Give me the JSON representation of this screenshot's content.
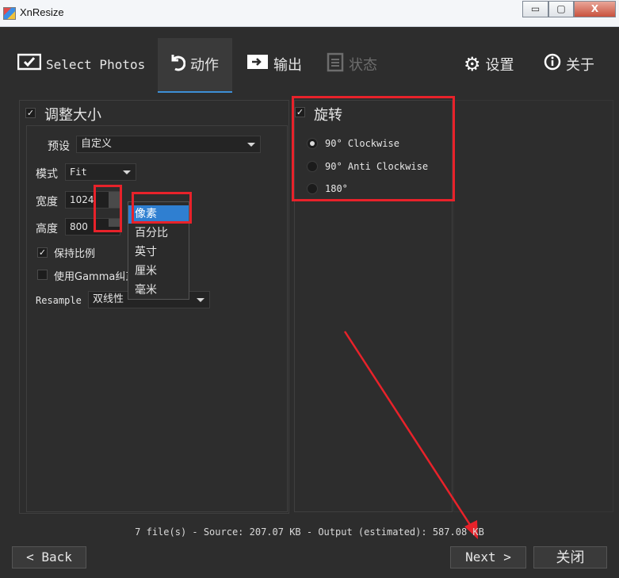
{
  "window": {
    "title": "XnResize",
    "controls": {
      "minimize": "▭",
      "maximize": "▢",
      "close": "X"
    }
  },
  "tabs": [
    {
      "label": "Select Photos",
      "icon": "select-photos-icon"
    },
    {
      "label": "动作",
      "icon": "action-icon"
    },
    {
      "label": "输出",
      "icon": "output-icon"
    },
    {
      "label": "状态",
      "icon": "status-icon"
    },
    {
      "label": "设置",
      "icon": "gear-icon"
    },
    {
      "label": "关于",
      "icon": "info-icon"
    }
  ],
  "resize": {
    "title": "调整大小",
    "checked": true,
    "preset_label": "预设",
    "preset_value": "自定义",
    "mode_label": "模式",
    "mode_value": "Fit",
    "width_label": "宽度",
    "width_value": "1024",
    "height_label": "高度",
    "height_value": "800",
    "keep_ratio_label": "保持比例",
    "keep_ratio_checked": true,
    "gamma_label": "使用Gamma纠正",
    "gamma_checked": false,
    "resample_label": "Resample",
    "resample_value": "双线性"
  },
  "unit_dropdown": {
    "items": [
      "像素",
      "百分比",
      "英寸",
      "厘米",
      "毫米"
    ],
    "selected": "像素"
  },
  "rotate": {
    "title": "旋转",
    "checked": true,
    "options": [
      {
        "label": "90°  Clockwise",
        "selected": true
      },
      {
        "label": "90°  Anti Clockwise",
        "selected": false
      },
      {
        "label": "180°",
        "selected": false
      }
    ]
  },
  "status_text": "7 file(s) - Source: 207.07 KB - Output (estimated): 587.08 KB",
  "buttons": {
    "back": "< Back",
    "next": "Next >",
    "close": "关闭"
  },
  "colors": {
    "annotation": "#e8222a",
    "accent": "#2f7fd1"
  }
}
